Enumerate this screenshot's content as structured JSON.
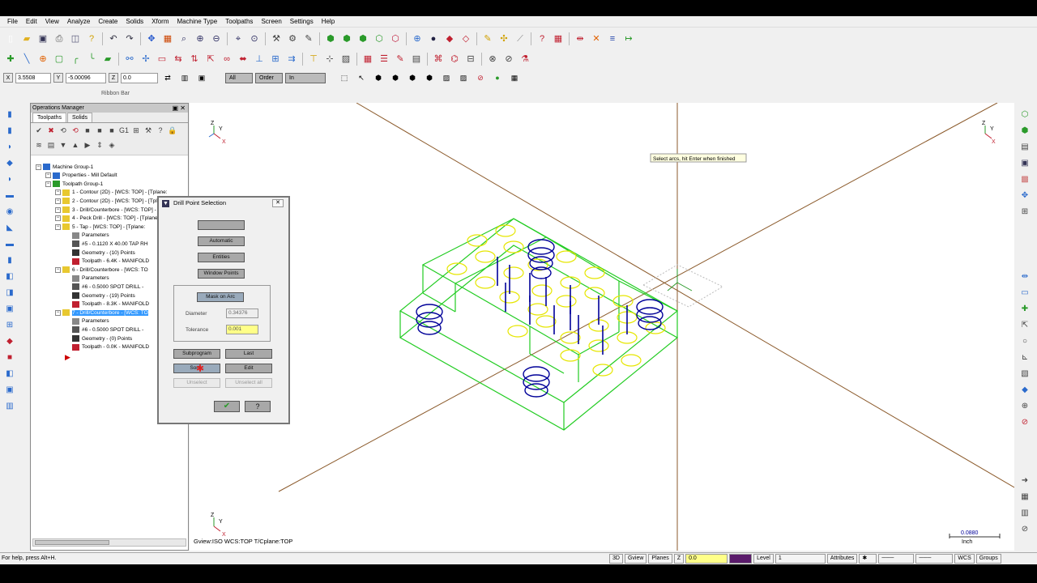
{
  "menu": [
    "File",
    "Edit",
    "View",
    "Analyze",
    "Create",
    "Solids",
    "Xform",
    "Machine Type",
    "Toolpaths",
    "Screen",
    "Settings",
    "Help"
  ],
  "ribbon": {
    "x_label": "X",
    "x_value": "3.5508",
    "y_label": "Y",
    "y_value": "-5.00096",
    "z_label": "Z",
    "z_value": "0.0",
    "btn_all": "All",
    "btn_order": "Order",
    "btn_in": "In",
    "caption": "Ribbon Bar"
  },
  "ops_manager": {
    "title": "Operations Manager",
    "tabs": [
      "Toolpaths",
      "Solids"
    ],
    "tree": [
      {
        "indent": 0,
        "text": "Machine Group-1",
        "icon": "machine"
      },
      {
        "indent": 1,
        "text": "Properties - Mill Default",
        "icon": "props"
      },
      {
        "indent": 1,
        "text": "Toolpath Group-1",
        "icon": "group"
      },
      {
        "indent": 2,
        "text": "1 - Contour (2D) - [WCS: TOP] - [Tplane:",
        "icon": "folder"
      },
      {
        "indent": 2,
        "text": "2 - Contour (2D) - [WCS: TOP] - [Tplane:",
        "icon": "folder"
      },
      {
        "indent": 2,
        "text": "3 - Drill/Counterbore - [WCS: TOP] - [Tplane:",
        "icon": "folder"
      },
      {
        "indent": 2,
        "text": "4 - Peck Drill - [WCS: TOP] - [Tplane:",
        "icon": "folder"
      },
      {
        "indent": 2,
        "text": "5 - Tap - [WCS: TOP] - [Tplane:",
        "icon": "folder"
      },
      {
        "indent": 3,
        "text": "Parameters",
        "icon": "param"
      },
      {
        "indent": 3,
        "text": "#5 - 0.1120 X 40.00 TAP RH",
        "icon": "tool"
      },
      {
        "indent": 3,
        "text": "Geometry - (10) Points",
        "icon": "geo"
      },
      {
        "indent": 3,
        "text": "Toolpath - 6.4K - MANIFOLD",
        "icon": "tp"
      },
      {
        "indent": 2,
        "text": "6 - Drill/Counterbore - [WCS: TO",
        "icon": "folder"
      },
      {
        "indent": 3,
        "text": "Parameters",
        "icon": "param"
      },
      {
        "indent": 3,
        "text": "#6 - 0.5000 SPOT DRILL -",
        "icon": "tool"
      },
      {
        "indent": 3,
        "text": "Geometry - (19) Points",
        "icon": "geo"
      },
      {
        "indent": 3,
        "text": "Toolpath - 8.3K - MANIFOLD",
        "icon": "tp"
      },
      {
        "indent": 2,
        "text": "7 - Drill/Counterbore - [WCS: TO",
        "icon": "folder",
        "selected": true
      },
      {
        "indent": 3,
        "text": "Parameters",
        "icon": "param"
      },
      {
        "indent": 3,
        "text": "#6 - 0.5000 SPOT DRILL -",
        "icon": "tool"
      },
      {
        "indent": 3,
        "text": "Geometry - (0) Points",
        "icon": "geo"
      },
      {
        "indent": 3,
        "text": "Toolpath - 0.0K - MANIFOLD",
        "icon": "tp"
      }
    ]
  },
  "dialog": {
    "title": "Drill Point Selection",
    "btn_manual": "",
    "btn_automatic": "Automatic",
    "btn_entities": "Entities",
    "btn_window_points": "Window Points",
    "btn_mask_on_arc": "Mask on Arc",
    "diameter_label": "Diameter",
    "diameter_value": "0.34376",
    "tolerance_label": "Tolerance",
    "tolerance_value": "0.001",
    "btn_subprogram": "Subprogram",
    "btn_last": "Last",
    "btn_sort": "Sort...",
    "btn_edit": "Edit",
    "btn_unselect": "Unselect",
    "btn_unselect_all": "Unselect all"
  },
  "viewport": {
    "prompt": "Select arcs, hit Enter when finished",
    "view_info": "Gview:ISO   WCS:TOP   T/Cplane:TOP",
    "scale_value": "0.0880",
    "scale_unit": "Inch",
    "axis_x": "X",
    "axis_y": "Y",
    "axis_z": "Z"
  },
  "status": {
    "help_text": "For help, press Alt+H.",
    "btn_3d": "3D",
    "btn_gview": "Gview",
    "btn_planes": "Planes",
    "z_label": "Z",
    "z_value": "0.0",
    "level_label": "Level",
    "level_value": "1",
    "btn_attributes": "Attributes",
    "btn_wcs": "WCS",
    "btn_groups": "Groups"
  },
  "colors": {
    "part_green": "#22cc22",
    "hole_yellow": "#e6e600",
    "hole_blue": "#000099",
    "construction": "#8b5a2b",
    "selection_blue": "#3399ff",
    "tolerance_yellow": "#ffff88"
  }
}
